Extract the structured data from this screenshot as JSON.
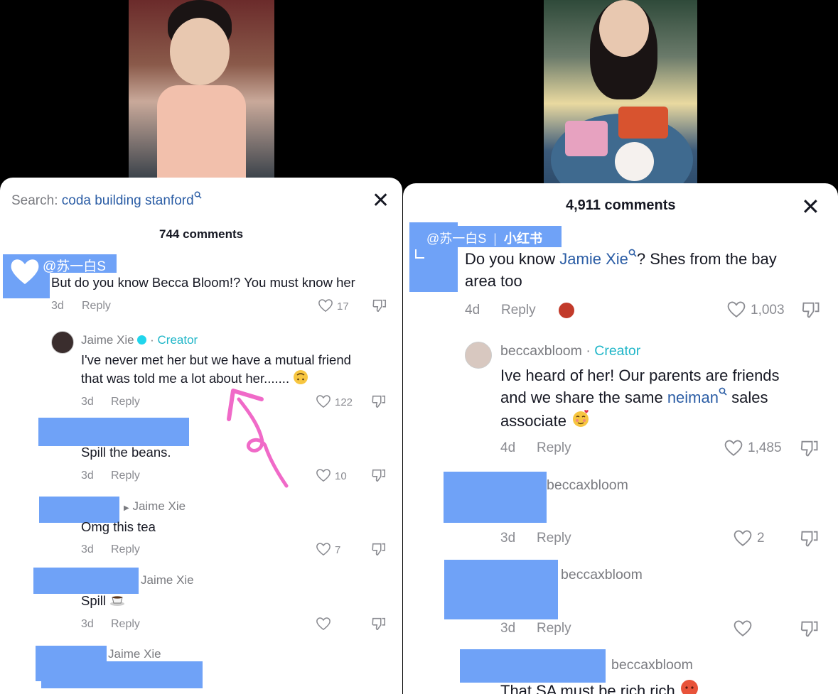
{
  "left": {
    "search_prefix": "Search:",
    "search_query": "coda building stanford",
    "comments_count": "744 comments",
    "watermark": "@苏一白S",
    "comments": [
      {
        "text": "But do you know Becca Bloom!? You must know her",
        "time": "3d",
        "reply": "Reply",
        "likes": "17"
      },
      {
        "author": "Jaime Xie",
        "badge": "Creator",
        "text_line1": "I've never met her but we have a mutual friend",
        "text_line2": "that was told me a lot about her.......",
        "time": "3d",
        "reply": "Reply",
        "likes": "122"
      },
      {
        "text": "Spill the beans.",
        "time": "3d",
        "reply": "Reply",
        "likes": "10"
      },
      {
        "reply_to": "Jaime Xie",
        "text": "Omg this tea",
        "time": "3d",
        "reply": "Reply",
        "likes": "7"
      },
      {
        "reply_to": "Jaime Xie",
        "text": "Spill",
        "time": "3d",
        "reply": "Reply"
      },
      {
        "reply_to": "Jaime Xie"
      }
    ]
  },
  "right": {
    "comments_count": "4,911 comments",
    "watermark": "@苏一白S",
    "watermark_app": "小红书",
    "comments": [
      {
        "text_pre": "Do you know ",
        "text_link": "Jamie Xie",
        "text_post": "? Shes from the bay",
        "text_line2": "area too",
        "time": "4d",
        "reply": "Reply",
        "likes": "1,003"
      },
      {
        "author": "beccaxbloom",
        "badge": "Creator",
        "text_line1": "Ive heard of her! Our parents are friends",
        "text_line2_pre": "and we share the same ",
        "text_line2_link": "neiman",
        "text_line2_post": " sales",
        "text_line3": "associate",
        "time": "4d",
        "reply": "Reply",
        "likes": "1,485"
      },
      {
        "reply_to": "beccaxbloom",
        "time": "3d",
        "reply": "Reply",
        "likes": "2"
      },
      {
        "reply_to": "beccaxbloom",
        "time": "3d",
        "reply": "Reply"
      },
      {
        "reply_to": "beccaxbloom",
        "text": "That SA must be rich rich"
      }
    ]
  },
  "colors": {
    "link": "#2b5da5",
    "creator": "#20b6c8",
    "redaction": "#6fa2f7",
    "annotation": "#f06ac8"
  },
  "icons": [
    "search-icon",
    "close-icon",
    "heart-icon",
    "dislike-icon",
    "verified-icon",
    "arrow-annotation"
  ]
}
